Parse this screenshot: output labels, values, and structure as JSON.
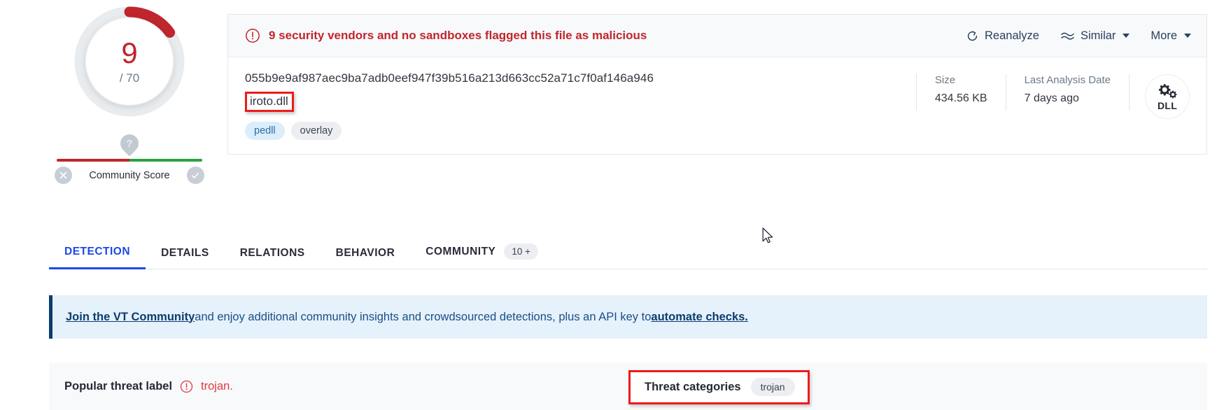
{
  "detection": {
    "count": "9",
    "total": "/ 70",
    "arc_color": "#c0262d",
    "community_score_label": "Community Score",
    "pin_glyph": "?",
    "downvote_icon": "x-circle-icon",
    "upvote_icon": "check-circle-icon"
  },
  "alert": {
    "icon": "exclamation-circle-icon",
    "text": "9 security vendors and no sandboxes flagged this file as malicious",
    "color": "#c0262d",
    "actions": [
      {
        "label": "Reanalyze",
        "icon": "refresh-icon"
      },
      {
        "label": "Similar",
        "icon": "similar-waves-icon",
        "caret": true
      },
      {
        "label": "More",
        "icon": "",
        "caret": true
      }
    ]
  },
  "file": {
    "hash": "055b9e9af987aec9ba7adb0eef947f39b516a213d663cc52a71c7f0af146a946",
    "name": "iroto.dll",
    "tags": [
      {
        "label": "pedll",
        "style": "blue"
      },
      {
        "label": "overlay",
        "style": "gray"
      }
    ],
    "meta": [
      {
        "label": "Size",
        "value": "434.56 KB"
      },
      {
        "label": "Last Analysis Date",
        "value": "7 days ago"
      }
    ],
    "type_icon": "gears-icon",
    "type_label": "DLL"
  },
  "tabs": [
    {
      "label": "DETECTION",
      "active": true,
      "badge": ""
    },
    {
      "label": "DETAILS",
      "active": false,
      "badge": ""
    },
    {
      "label": "RELATIONS",
      "active": false,
      "badge": ""
    },
    {
      "label": "BEHAVIOR",
      "active": false,
      "badge": ""
    },
    {
      "label": "COMMUNITY",
      "active": false,
      "badge": "10 +"
    }
  ],
  "banner": {
    "link1": "Join the VT Community",
    "middle": " and enjoy additional community insights and crowdsourced detections, plus an API key to ",
    "link2": "automate checks.",
    "accent": "#0b3d6e"
  },
  "threat": {
    "popular_label": "Popular threat label",
    "popular_icon": "exclamation-circle-icon",
    "popular_value": "trojan.",
    "categories_title": "Threat categories",
    "categories_value": "trojan"
  },
  "cursor": {
    "icon": "arrow-cursor",
    "x": "1089",
    "y": "325"
  }
}
